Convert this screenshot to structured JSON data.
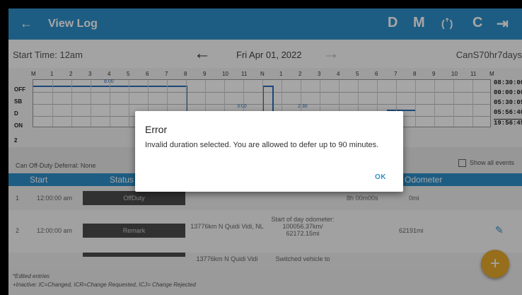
{
  "topbar": {
    "back_icon": "←",
    "title": "View Log",
    "actions": [
      "D",
      "M",
      "(ꜛ)",
      "C",
      "⇥"
    ]
  },
  "info": {
    "start_time": "Start Time: 12am",
    "date": "Fri Apr 01, 2022",
    "cycle": "CanS70hr7days"
  },
  "graph": {
    "hour_labels": [
      "M",
      "1",
      "2",
      "3",
      "4",
      "5",
      "6",
      "7",
      "8",
      "9",
      "10",
      "11",
      "N",
      "1",
      "2",
      "3",
      "4",
      "5",
      "6",
      "7",
      "8",
      "9",
      "10",
      "11",
      "M"
    ],
    "rows": [
      "OFF",
      "SB",
      "D",
      "ON"
    ],
    "totals": [
      "08:30:00",
      "00:00:00",
      "05:30:05",
      "05:56:40"
    ],
    "sum_total": "19:56:45",
    "edited_count": "2",
    "annotations": [
      "8:00",
      "3:00",
      "2:30"
    ]
  },
  "deferral": "Can Off-Duty Deferral: None",
  "show_all": "Show all events",
  "table": {
    "headers": [
      "Start",
      "Status",
      "Odometer"
    ],
    "rows": [
      {
        "num": "1",
        "start": "12:00:00 am",
        "status": "OffDuty",
        "location": "",
        "notes": "",
        "duration": "8h 00m00s",
        "odometer": "0mi"
      },
      {
        "num": "2",
        "start": "12:00:00 am",
        "status": "Remark",
        "location": "13776km N Quidi Vidi, NL",
        "notes": "Start of day odometer: 100056.37km/ 62172.15mi",
        "duration": "",
        "odometer": "62191mi"
      },
      {
        "num": "",
        "start": "",
        "status": "",
        "location": "13776km N Quidi Vidi",
        "notes": "Switched vehicle to",
        "duration": "",
        "odometer": ""
      }
    ]
  },
  "footer_notes": {
    "line1": "*Edited entries",
    "line2": "+Inactive: IC=Changed, ICR=Change Requested, ICJ= Change Rejected"
  },
  "fab_label": "+",
  "dialog": {
    "title": "Error",
    "message": "Invalid duration selected. You are allowed to defer up to 90 minutes.",
    "ok_label": "OK"
  }
}
